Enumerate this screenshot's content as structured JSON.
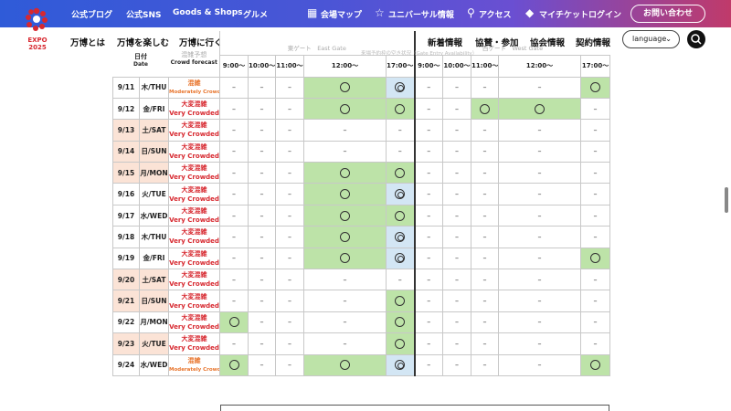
{
  "top_nav": {
    "links": [
      "公式ブログ",
      "公式SNS",
      "Goods & Shops",
      "グルメ"
    ],
    "right_links": [
      "会場マップ",
      "ユニバーサル情報",
      "アクセス",
      "マイチケットログイン"
    ],
    "contact": "お問い合わせ"
  },
  "logo": {
    "line1": "EXPO",
    "line2": "2025"
  },
  "second_nav": {
    "items": [
      "万博とは",
      "万博を楽しむ",
      "万博に行く",
      "新着情報",
      "協賛・参加",
      "協会情報",
      "契約情報"
    ],
    "language": "language"
  },
  "table": {
    "faded_title": "来場予約枠の空き状況（Gate Entry Availability）",
    "header": {
      "date_ja": "日付",
      "date_en": "Date",
      "crowd_ja": "混雑予想",
      "crowd_en": "Crowd forecast",
      "east_gate": "東ゲート　East Gate",
      "west_gate": "西ゲート　West Gate",
      "slots": [
        "9:00〜",
        "10:00〜",
        "11:00〜",
        "12:00〜",
        "17:00〜",
        "9:00〜",
        "10:00〜",
        "11:00〜",
        "12:00〜",
        "17:00〜"
      ]
    },
    "dash": "–",
    "rows": [
      {
        "date": "9/11",
        "dow": "木/THU",
        "crowd_ja": "混雑",
        "crowd_en": "Moderately Crowded",
        "mod": true,
        "wk": false,
        "cells": [
          "-",
          "-",
          "-",
          "G",
          "D",
          "-",
          "-",
          "-",
          "-",
          "G"
        ]
      },
      {
        "date": "9/12",
        "dow": "金/FRI",
        "crowd_ja": "大変混雑",
        "crowd_en": "Very Crowded",
        "mod": false,
        "wk": false,
        "cells": [
          "-",
          "-",
          "-",
          "G",
          "G",
          "-",
          "-",
          "G",
          "G",
          "-"
        ]
      },
      {
        "date": "9/13",
        "dow": "土/SAT",
        "crowd_ja": "大変混雑",
        "crowd_en": "Very Crowded",
        "mod": false,
        "wk": true,
        "cells": [
          "-",
          "-",
          "-",
          "-",
          "-",
          "-",
          "-",
          "-",
          "-",
          "-"
        ]
      },
      {
        "date": "9/14",
        "dow": "日/SUN",
        "crowd_ja": "大変混雑",
        "crowd_en": "Very Crowded",
        "mod": false,
        "wk": true,
        "cells": [
          "-",
          "-",
          "-",
          "-",
          "-",
          "-",
          "-",
          "-",
          "-",
          "-"
        ]
      },
      {
        "date": "9/15",
        "dow": "月/MON",
        "crowd_ja": "大変混雑",
        "crowd_en": "Very Crowded",
        "mod": false,
        "wk": true,
        "cells": [
          "-",
          "-",
          "-",
          "G",
          "G",
          "-",
          "-",
          "-",
          "-",
          "-"
        ]
      },
      {
        "date": "9/16",
        "dow": "火/TUE",
        "crowd_ja": "大変混雑",
        "crowd_en": "Very Crowded",
        "mod": false,
        "wk": false,
        "cells": [
          "-",
          "-",
          "-",
          "G",
          "D",
          "-",
          "-",
          "-",
          "-",
          "-"
        ]
      },
      {
        "date": "9/17",
        "dow": "水/WED",
        "crowd_ja": "大変混雑",
        "crowd_en": "Very Crowded",
        "mod": false,
        "wk": false,
        "cells": [
          "-",
          "-",
          "-",
          "G",
          "G",
          "-",
          "-",
          "-",
          "-",
          "-"
        ]
      },
      {
        "date": "9/18",
        "dow": "木/THU",
        "crowd_ja": "大変混雑",
        "crowd_en": "Very Crowded",
        "mod": false,
        "wk": false,
        "cells": [
          "-",
          "-",
          "-",
          "G",
          "D",
          "-",
          "-",
          "-",
          "-",
          "-"
        ]
      },
      {
        "date": "9/19",
        "dow": "金/FRI",
        "crowd_ja": "大変混雑",
        "crowd_en": "Very Crowded",
        "mod": false,
        "wk": false,
        "cells": [
          "-",
          "-",
          "-",
          "G",
          "D",
          "-",
          "-",
          "-",
          "-",
          "G"
        ]
      },
      {
        "date": "9/20",
        "dow": "土/SAT",
        "crowd_ja": "大変混雑",
        "crowd_en": "Very Crowded",
        "mod": false,
        "wk": true,
        "cells": [
          "-",
          "-",
          "-",
          "-",
          "-",
          "-",
          "-",
          "-",
          "-",
          "-"
        ]
      },
      {
        "date": "9/21",
        "dow": "日/SUN",
        "crowd_ja": "大変混雑",
        "crowd_en": "Very Crowded",
        "mod": false,
        "wk": true,
        "cells": [
          "-",
          "-",
          "-",
          "-",
          "G",
          "-",
          "-",
          "-",
          "-",
          "-"
        ]
      },
      {
        "date": "9/22",
        "dow": "月/MON",
        "crowd_ja": "大変混雑",
        "crowd_en": "Very Crowded",
        "mod": false,
        "wk": false,
        "cells": [
          "G",
          "-",
          "-",
          "-",
          "G",
          "-",
          "-",
          "-",
          "-",
          "-"
        ]
      },
      {
        "date": "9/23",
        "dow": "火/TUE",
        "crowd_ja": "大変混雑",
        "crowd_en": "Very Crowded",
        "mod": false,
        "wk": true,
        "cells": [
          "-",
          "-",
          "-",
          "-",
          "G",
          "-",
          "-",
          "-",
          "-",
          "-"
        ]
      },
      {
        "date": "9/24",
        "dow": "水/WED",
        "crowd_ja": "混雑",
        "crowd_en": "Moderately Crowded",
        "mod": true,
        "wk": false,
        "cells": [
          "G",
          "-",
          "-",
          "G",
          "D",
          "-",
          "-",
          "-",
          "-",
          "G"
        ]
      }
    ]
  },
  "colors": {
    "available": "#bde3a8",
    "plenty": "#d3e6f4",
    "holiday": "#fbe3d6",
    "accent": "#d7282f"
  }
}
